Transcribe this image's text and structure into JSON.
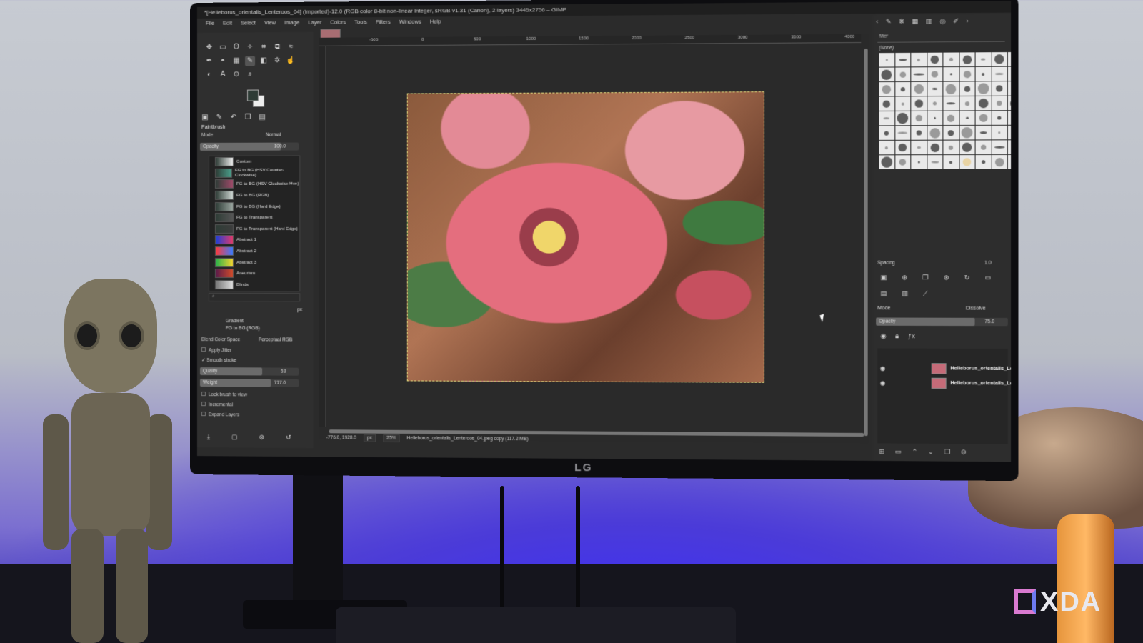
{
  "window": {
    "title": "*[Helleborus_orientalis_Lenteroos_04] (imported)-12.0 (RGB color 8-bit non-linear integer, sRGB v1.31 (Canon), 2 layers) 3445x2756 – GIMP"
  },
  "menu": [
    "File",
    "Edit",
    "Select",
    "View",
    "Image",
    "Layer",
    "Colors",
    "Tools",
    "Filters",
    "Windows",
    "Help"
  ],
  "toolbox": {
    "tool_icons": [
      "move-icon",
      "rect-select-icon",
      "lasso-icon",
      "fuzzy-select-icon",
      "crop-icon",
      "unified-transform-icon",
      "warp-icon",
      "path-icon",
      "bucket-icon",
      "gradient-icon",
      "paintbrush-icon",
      "eraser-icon",
      "clone-icon",
      "smudge-icon",
      "dodge-icon",
      "text-icon",
      "color-picker-icon",
      "zoom-icon"
    ],
    "fg_color": "#2e3c36",
    "bg_color": "#ededed"
  },
  "tool_options": {
    "title": "Paintbrush",
    "mode_label": "Mode",
    "mode_value": "Normal",
    "opacity_label": "Opacity",
    "opacity_value": "100.0",
    "opacity_level": 1.0,
    "gradients": [
      {
        "name": "Custom",
        "colors": [
          "#2e3c36",
          "#ededed"
        ]
      },
      {
        "name": "FG to BG (HSV Counter-Clockwise)",
        "colors": [
          "#2e3c36",
          "#4a9e8a"
        ]
      },
      {
        "name": "FG to BG (HSV Clockwise Hue)",
        "colors": [
          "#2e3c36",
          "#a04a6a"
        ]
      },
      {
        "name": "FG to BG (RGB)",
        "colors": [
          "#2e3c36",
          "#cfd7d3"
        ]
      },
      {
        "name": "FG to BG (Hard Edge)",
        "colors": [
          "#2e3c36",
          "#9aa59f"
        ]
      },
      {
        "name": "FG to Transparent",
        "colors": [
          "#2e3c36",
          "#555555"
        ]
      },
      {
        "name": "FG to Transparent (Hard Edge)",
        "colors": [
          "#2e3c36",
          "#3d3d3d"
        ]
      },
      {
        "name": "Abstract 1",
        "colors": [
          "#1d3fd8",
          "#e23a6a"
        ]
      },
      {
        "name": "Abstract 2",
        "colors": [
          "#ff3a3a",
          "#3a7aff"
        ]
      },
      {
        "name": "Abstract 3",
        "colors": [
          "#29b14a",
          "#f2d431"
        ]
      },
      {
        "name": "Aneurism",
        "colors": [
          "#5a1a4a",
          "#d14a2a"
        ]
      },
      {
        "name": "Blinds",
        "colors": [
          "#777777",
          "#dddddd"
        ]
      }
    ],
    "gradient_label": "Gradient",
    "gradient_value": "FG to BG (RGB)",
    "blend_space_label": "Blend Color Space",
    "blend_space_value": "Perceptual RGB",
    "apply_jitter": "Apply Jitter",
    "smooth_stroke": "Smooth stroke",
    "quality_label": "Quality",
    "quality_value": "63",
    "quality_level": 0.63,
    "weight_label": "Weight",
    "weight_value": "717.0",
    "weight_level": 0.72,
    "lock_brush": "Lock brush to view",
    "incremental": "Incremental",
    "expand_layers": "Expand Layers",
    "unit_px": "px"
  },
  "canvas": {
    "ruler_labels": [
      "-500",
      "0",
      "500",
      "1000",
      "1500",
      "2000",
      "2500",
      "3000",
      "3500",
      "4000"
    ],
    "coords": "-776.0, 1928.0",
    "unit": "px",
    "zoom": "25%",
    "status": "Helleborus_orientalis_Lenteroos_04.jpeg copy (117.2 MB)"
  },
  "brushes": {
    "filter_placeholder": "filter",
    "selected": "(None)",
    "spacing_label": "Spacing",
    "spacing_value": "1.0"
  },
  "layers": {
    "mode_label": "Mode",
    "mode_value": "Dissolve",
    "opacity_label": "Opacity",
    "opacity_value": "75.0",
    "opacity_level": 0.75,
    "items": [
      {
        "name": "Helleborus_orientalis_Lenter"
      },
      {
        "name": "Helleborus_orientalis_Lenter"
      }
    ]
  },
  "monitor_brand": "LG",
  "watermark": "XDA"
}
